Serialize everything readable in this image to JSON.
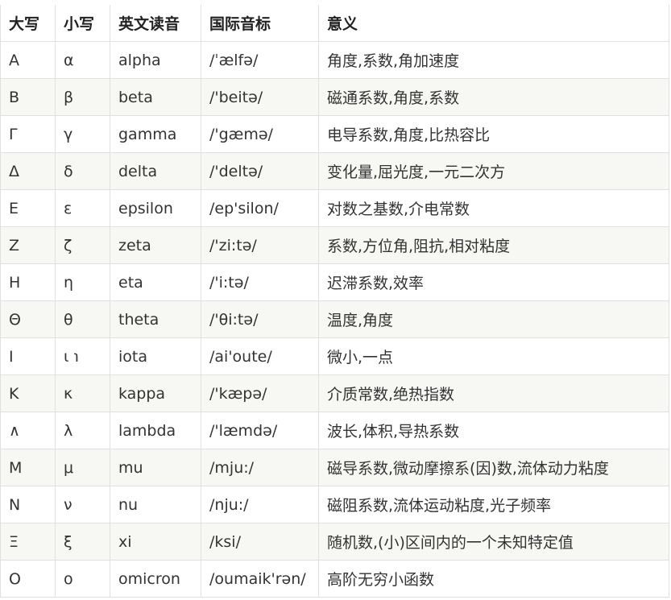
{
  "table": {
    "headers": [
      "大写",
      "小写",
      "英文读音",
      "国际音标",
      "意义"
    ],
    "rows": [
      [
        "Α",
        "α",
        "alpha",
        "/ˈælfə/",
        "角度,系数,角加速度"
      ],
      [
        "Β",
        "β",
        "beta",
        "/'beitə/",
        "磁通系数,角度,系数"
      ],
      [
        "Γ",
        "γ",
        "gamma",
        "/'gæmə/",
        "电导系数,角度,比热容比"
      ],
      [
        "Δ",
        "δ",
        "delta",
        "/'deltə/",
        "变化量,屈光度,一元二次方"
      ],
      [
        "Ε",
        "ε",
        "epsilon",
        "/ep'silon/",
        "对数之基数,介电常数"
      ],
      [
        "Ζ",
        "ζ",
        "zeta",
        "/'zi:tə/",
        "系数,方位角,阻抗,相对粘度"
      ],
      [
        "Η",
        "η",
        "eta",
        "/'i:tə/",
        "迟滞系数,效率"
      ],
      [
        "Θ",
        "θ",
        "theta",
        "/'θi:tə/",
        "温度,角度"
      ],
      [
        "Ι",
        "ι ℩",
        "iota",
        "/ai'oute/",
        "微小,一点"
      ],
      [
        "Κ",
        "κ",
        "kappa",
        "/'kæpə/",
        "介质常数,绝热指数"
      ],
      [
        "∧",
        "λ",
        "lambda",
        "/'læmdə/",
        "波长,体积,导热系数"
      ],
      [
        "Μ",
        "μ",
        "mu",
        "/mju:/",
        "磁导系数,微动摩擦系(因)数,流体动力粘度"
      ],
      [
        "Ν",
        "ν",
        "nu",
        "/nju:/",
        "磁阻系数,流体运动粘度,光子频率"
      ],
      [
        "Ξ",
        "ξ",
        "xi",
        "/ksi/",
        "随机数,(小)区间内的一个未知特定值"
      ],
      [
        "Ο",
        "ο",
        "omicron",
        "/oumaik'rən/",
        "高阶无穷小函数"
      ]
    ]
  }
}
